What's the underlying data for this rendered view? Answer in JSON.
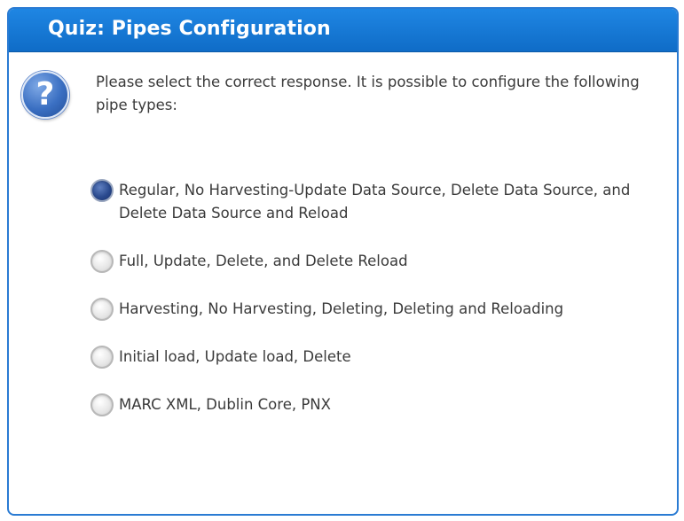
{
  "quiz": {
    "title": "Quiz: Pipes Configuration",
    "question_icon": "question-mark-icon",
    "question_glyph": "?",
    "question": "Please select the correct response.  It is possible to configure the following pipe types:",
    "accent_color": "#1a7ad6",
    "selected_color": "#2a4a8e",
    "options": [
      {
        "label": "Regular, No Harvesting-Update Data Source, Delete Data Source, and Delete Data Source and Reload",
        "selected": true
      },
      {
        "label": "Full, Update, Delete, and Delete Reload",
        "selected": false
      },
      {
        "label": "Harvesting, No Harvesting, Deleting, Deleting and Reloading",
        "selected": false
      },
      {
        "label": "Initial load, Update load, Delete",
        "selected": false
      },
      {
        "label": "MARC XML, Dublin Core, PNX",
        "selected": false
      }
    ]
  }
}
